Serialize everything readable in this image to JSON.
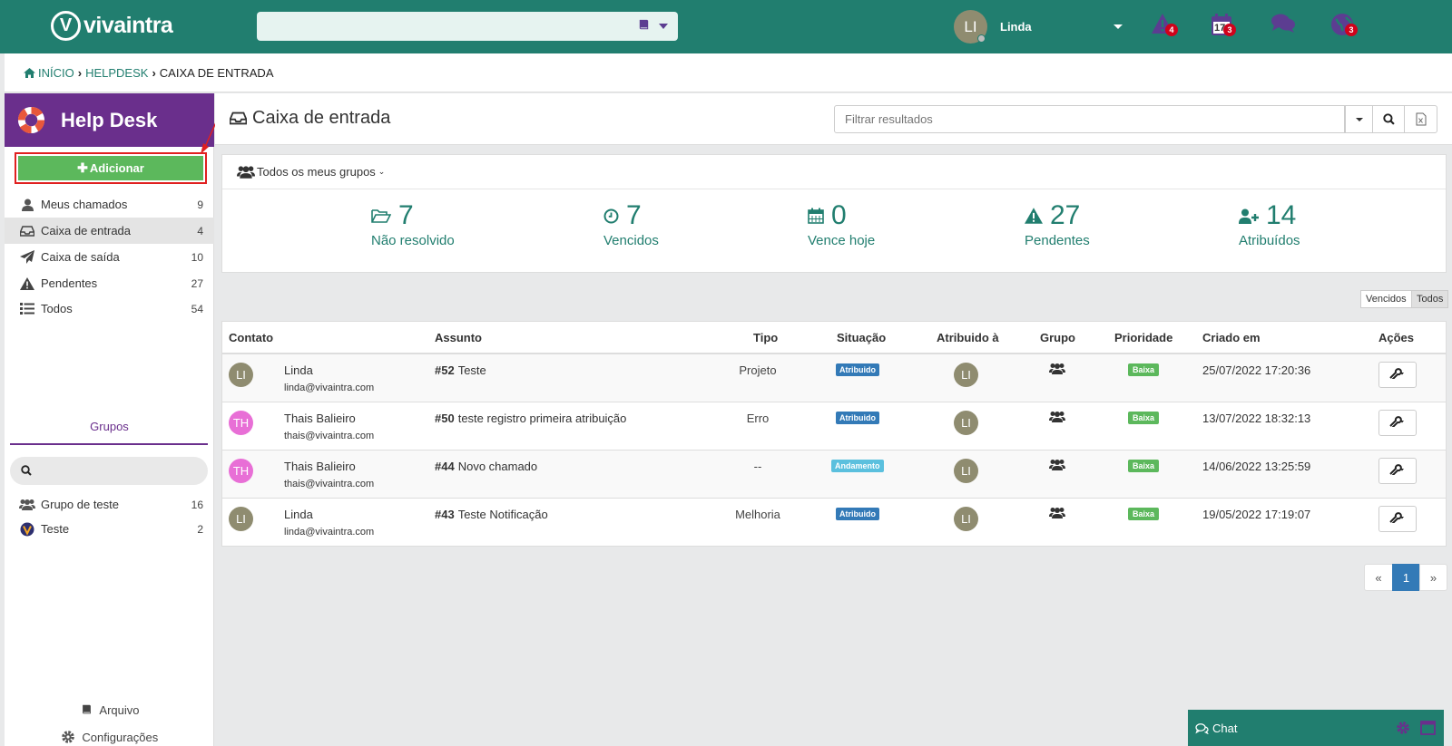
{
  "app": {
    "logo_letter": "V",
    "logo_text": "vivaintra"
  },
  "topbar": {
    "user_initials": "LI",
    "user_name": "Linda",
    "alerts_badge": "4",
    "calendar_day": "17",
    "calendar_badge": "3",
    "globe_badge": "3"
  },
  "breadcrumb": {
    "home": "INÍCIO",
    "helpdesk": "HELPDESK",
    "current": "CAIXA DE ENTRADA"
  },
  "sidebar": {
    "title": "Help Desk",
    "add_label": "Adicionar",
    "items": [
      {
        "label": "Meus chamados",
        "count": "9"
      },
      {
        "label": "Caixa de entrada",
        "count": "4"
      },
      {
        "label": "Caixa de saída",
        "count": "10"
      },
      {
        "label": "Pendentes",
        "count": "27"
      },
      {
        "label": "Todos",
        "count": "54"
      }
    ],
    "groups_title": "Grupos",
    "groups": [
      {
        "label": "Grupo de teste",
        "count": "16"
      },
      {
        "label": "Teste",
        "count": "2"
      }
    ],
    "footer": {
      "archive": "Arquivo",
      "settings": "Configurações"
    }
  },
  "main": {
    "title": "Caixa de entrada",
    "filter_placeholder": "Filtrar resultados",
    "group_selector": "Todos os meus grupos",
    "stats": [
      {
        "value": "7",
        "label": "Não resolvido"
      },
      {
        "value": "7",
        "label": "Vencidos"
      },
      {
        "value": "0",
        "label": "Vence hoje"
      },
      {
        "value": "27",
        "label": "Pendentes"
      },
      {
        "value": "14",
        "label": "Atribuídos"
      }
    ],
    "toggle": {
      "overdue": "Vencidos",
      "all": "Todos"
    },
    "table": {
      "headers": [
        "Contato",
        "Assunto",
        "Tipo",
        "Situação",
        "Atribuido à",
        "Grupo",
        "Prioridade",
        "Criado em",
        "Ações"
      ],
      "rows": [
        {
          "initials": "LI",
          "name": "Linda",
          "email": "linda@vivaintra.com",
          "num": "#52",
          "subject": "Teste",
          "type": "Projeto",
          "status": "Atribuido",
          "assignee": "LI",
          "priority": "Baixa",
          "created": "25/07/2022 17:20:36"
        },
        {
          "initials": "TH",
          "name": "Thais Balieiro",
          "email": "thais@vivaintra.com",
          "num": "#50",
          "subject": "teste registro primeira atribuição",
          "type": "Erro",
          "status": "Atribuido",
          "assignee": "LI",
          "priority": "Baixa",
          "created": "13/07/2022 18:32:13"
        },
        {
          "initials": "TH",
          "name": "Thais Balieiro",
          "email": "thais@vivaintra.com",
          "num": "#44",
          "subject": "Novo chamado",
          "type": "--",
          "status": "Andamento",
          "assignee": "LI",
          "priority": "Baixa",
          "created": "14/06/2022 13:25:59"
        },
        {
          "initials": "LI",
          "name": "Linda",
          "email": "linda@vivaintra.com",
          "num": "#43",
          "subject": "Teste Notificação",
          "type": "Melhoria",
          "status": "Atribuido",
          "assignee": "LI",
          "priority": "Baixa",
          "created": "19/05/2022 17:19:07"
        }
      ]
    },
    "pagination": {
      "prev": "«",
      "page": "1",
      "next": "»"
    }
  },
  "chat": {
    "label": "Chat"
  },
  "colors": {
    "teal": "#217e6f",
    "purple": "#6a2f8c",
    "green": "#5cb85c",
    "blue_status": "#337ab7",
    "cyan_status": "#5bc0de",
    "pink_avatar": "#e86fd6",
    "olive_avatar": "#8f8c70",
    "badge_red": "#d0021b"
  }
}
